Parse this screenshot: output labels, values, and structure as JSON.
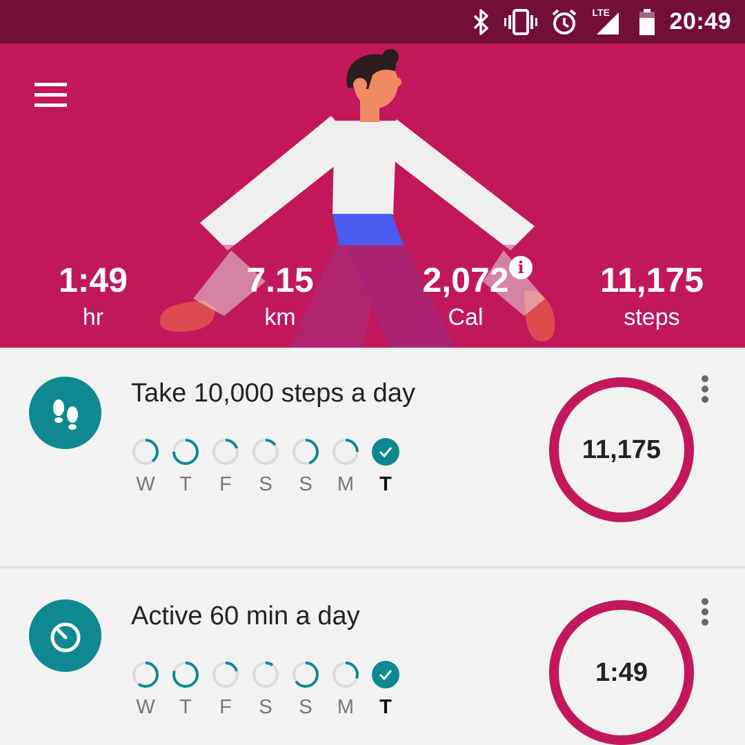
{
  "status_bar": {
    "time": "20:49",
    "network_label": "LTE",
    "icons": [
      "bluetooth-icon",
      "vibrate-icon",
      "alarm-icon",
      "lte-signal-icon",
      "battery-icon"
    ]
  },
  "colors": {
    "status_bar": "#730e37",
    "hero": "#c2185b",
    "teal": "#0e8891",
    "ring": "#c2185b",
    "background": "#f2f2f2"
  },
  "hero": {
    "menu_icon": "menu-icon",
    "stats": [
      {
        "value": "1:49",
        "unit": "hr"
      },
      {
        "value": "7.15",
        "unit": "km"
      },
      {
        "value": "2,072",
        "unit": "Cal"
      },
      {
        "value": "11,175",
        "unit": "steps"
      }
    ],
    "info_icon_glyph": "i"
  },
  "goals": [
    {
      "title": "Take 10,000 steps a day",
      "icon": "footsteps-icon",
      "value": "11,175",
      "progress": 1.0,
      "days": [
        {
          "label": "W",
          "progress": 0.4,
          "done": false,
          "today": false
        },
        {
          "label": "T",
          "progress": 0.75,
          "done": false,
          "today": false
        },
        {
          "label": "F",
          "progress": 0.2,
          "done": false,
          "today": false
        },
        {
          "label": "S",
          "progress": 0.15,
          "done": false,
          "today": false
        },
        {
          "label": "S",
          "progress": 0.45,
          "done": false,
          "today": false
        },
        {
          "label": "M",
          "progress": 0.25,
          "done": false,
          "today": false
        },
        {
          "label": "T",
          "progress": 1.0,
          "done": true,
          "today": true
        }
      ]
    },
    {
      "title": "Active 60 min a day",
      "icon": "timer-icon",
      "value": "1:49",
      "progress": 1.0,
      "days": [
        {
          "label": "W",
          "progress": 0.6,
          "done": false,
          "today": false
        },
        {
          "label": "T",
          "progress": 0.8,
          "done": false,
          "today": false
        },
        {
          "label": "F",
          "progress": 0.2,
          "done": false,
          "today": false
        },
        {
          "label": "S",
          "progress": 0.1,
          "done": false,
          "today": false
        },
        {
          "label": "S",
          "progress": 0.65,
          "done": false,
          "today": false
        },
        {
          "label": "M",
          "progress": 0.3,
          "done": false,
          "today": false
        },
        {
          "label": "T",
          "progress": 1.0,
          "done": true,
          "today": true
        }
      ]
    }
  ]
}
